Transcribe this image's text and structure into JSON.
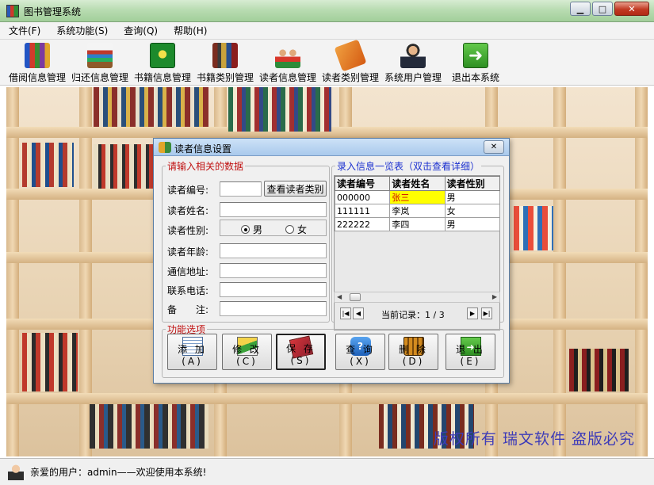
{
  "window": {
    "title": "图书管理系统"
  },
  "menu": [
    "文件(F)",
    "系统功能(S)",
    "查询(Q)",
    "帮助(H)"
  ],
  "toolbar": [
    {
      "label": "借阅信息管理",
      "icon": "books-icon"
    },
    {
      "label": "归还信息管理",
      "icon": "bookshelf-icon"
    },
    {
      "label": "书籍信息管理",
      "icon": "green-book-icon"
    },
    {
      "label": "书籍类别管理",
      "icon": "book-category-icon"
    },
    {
      "label": "读者信息管理",
      "icon": "readers-icon"
    },
    {
      "label": "读者类别管理",
      "icon": "orange-book-icon"
    },
    {
      "label": "系统用户管理",
      "icon": "user-icon"
    },
    {
      "label": "退出本系统",
      "icon": "exit-arrow-icon"
    }
  ],
  "copyright": "版权所有  瑞文软件  盗版必究",
  "status": {
    "text": "亲爱的用户：admin——欢迎使用本系统!"
  },
  "dialog": {
    "title": "读者信息设置",
    "input_group": "请输入相关的数据",
    "labels": {
      "reader_id": "读者编号:",
      "reader_name": "读者姓名:",
      "reader_gender": "读者性别:",
      "reader_age": "读者年龄:",
      "address": "通信地址:",
      "phone": "联系电话:",
      "remark": "备　　注:"
    },
    "values": {
      "reader_id": "",
      "reader_name": "",
      "reader_age": "",
      "address": "",
      "phone": "",
      "remark": ""
    },
    "view_category_button": "查看读者类别",
    "gender_options": {
      "male": "男",
      "female": "女",
      "selected": "男"
    },
    "list_group": "录入信息一览表（双击查看详细）",
    "table": {
      "headers": [
        "读者编号",
        "读者姓名",
        "读者性别"
      ],
      "rows": [
        [
          "000000",
          "张三",
          "男"
        ],
        [
          "111111",
          "李岚",
          "女"
        ],
        [
          "222222",
          "李四",
          "男"
        ]
      ]
    },
    "record_text": "当前记录：1 / 3",
    "function_group": "功能选项",
    "buttons": {
      "add": "添 加(A)",
      "edit": "修 改(C)",
      "save": "保 存(S)",
      "query": "查 询(X)",
      "delete": "删 除(D)",
      "exit": "退 出(E)"
    }
  }
}
